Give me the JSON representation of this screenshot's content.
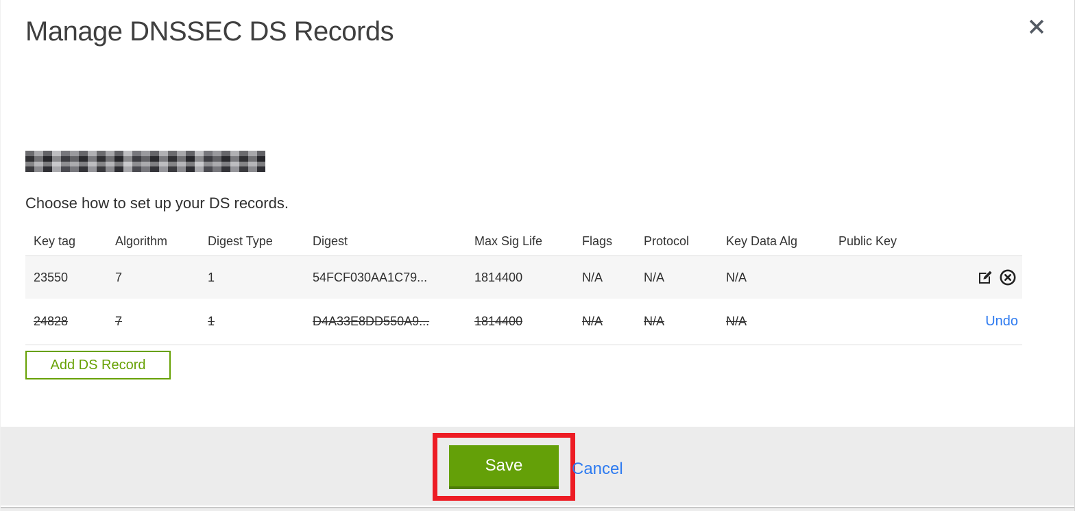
{
  "dialog": {
    "title": "Manage DNSSEC DS Records",
    "instruction": "Choose how to set up your DS records."
  },
  "table": {
    "columns": [
      "Key tag",
      "Algorithm",
      "Digest Type",
      "Digest",
      "Max Sig Life",
      "Flags",
      "Protocol",
      "Key Data Alg",
      "Public Key"
    ],
    "rows": [
      {
        "key_tag": "23550",
        "algorithm": "7",
        "digest_type": "1",
        "digest": "54FCF030AA1C79...",
        "max_sig_life": "1814400",
        "flags": "N/A",
        "protocol": "N/A",
        "key_data_alg": "N/A",
        "public_key": "",
        "state": "active"
      },
      {
        "key_tag": "24828",
        "algorithm": "7",
        "digest_type": "1",
        "digest": "D4A33E8DD550A9...",
        "max_sig_life": "1814400",
        "flags": "N/A",
        "protocol": "N/A",
        "key_data_alg": "N/A",
        "public_key": "",
        "state": "marked-for-deletion",
        "undo_label": "Undo"
      }
    ]
  },
  "buttons": {
    "add_ds_record": "Add DS Record",
    "save": "Save",
    "cancel": "Cancel"
  },
  "icons": {
    "close": "close-icon",
    "edit": "edit-icon",
    "delete": "circle-x-icon"
  },
  "colors": {
    "accent_green": "#64a008",
    "accent_green_dark": "#4e7d08",
    "outline_green": "#67a104",
    "link_blue": "#2e7bf0",
    "annotation_red": "#ed1c24",
    "footer_bg": "#ececec",
    "row_stripe_bg": "#f6f6f6"
  }
}
